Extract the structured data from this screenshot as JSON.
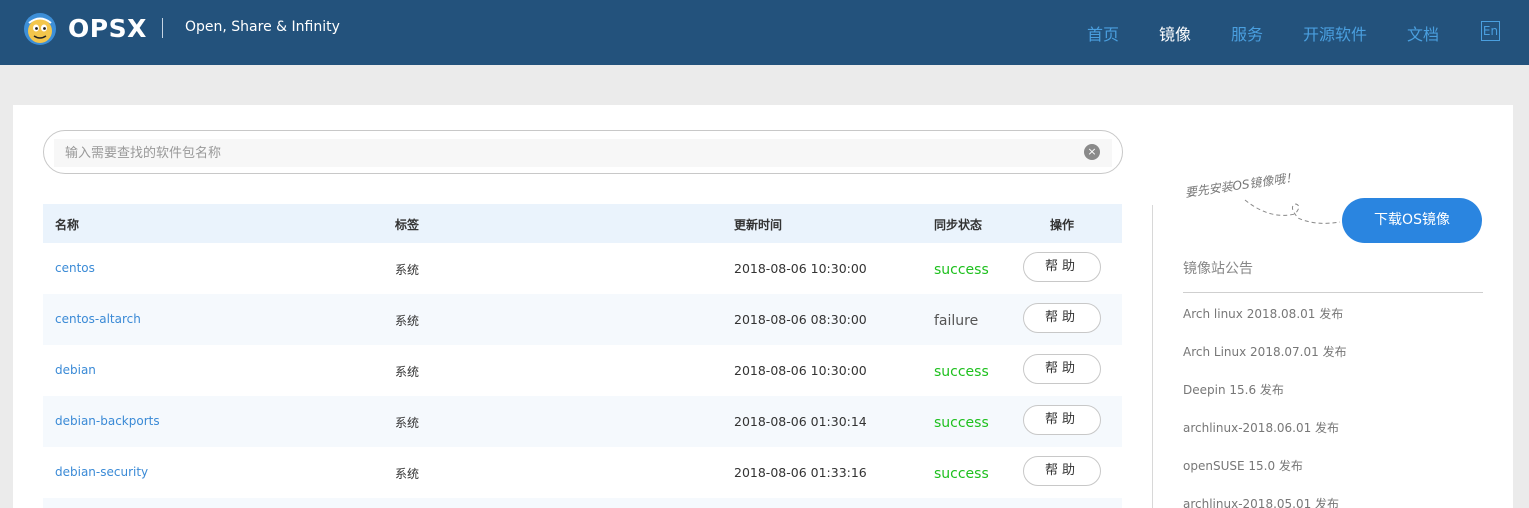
{
  "header": {
    "brand": "OPSX",
    "tagline": "Open, Share & Infinity",
    "nav": [
      {
        "label": "首页",
        "active": false
      },
      {
        "label": "镜像",
        "active": true
      },
      {
        "label": "服务",
        "active": false
      },
      {
        "label": "开源软件",
        "active": false
      },
      {
        "label": "文档",
        "active": false
      }
    ],
    "lang_label": "En"
  },
  "search": {
    "placeholder": "输入需要查找的软件包名称",
    "value": "",
    "clear_icon": "×"
  },
  "table": {
    "columns": [
      "名称",
      "标签",
      "更新时间",
      "同步状态",
      "操作"
    ],
    "rows": [
      {
        "name": "centos",
        "tag": "系统",
        "time": "2018-08-06 10:30:00",
        "status": "success",
        "action": "帮助"
      },
      {
        "name": "centos-altarch",
        "tag": "系统",
        "time": "2018-08-06 08:30:00",
        "status": "failure",
        "action": "帮助"
      },
      {
        "name": "debian",
        "tag": "系统",
        "time": "2018-08-06 10:30:00",
        "status": "success",
        "action": "帮助"
      },
      {
        "name": "debian-backports",
        "tag": "系统",
        "time": "2018-08-06 01:30:14",
        "status": "success",
        "action": "帮助"
      },
      {
        "name": "debian-security",
        "tag": "系统",
        "time": "2018-08-06 01:33:16",
        "status": "success",
        "action": "帮助"
      }
    ]
  },
  "sidebar": {
    "hint": "要先安装OS镜像哦！",
    "download_label": "下载OS镜像",
    "notice_title": "镜像站公告",
    "notices": [
      "Arch linux 2018.08.01 发布",
      "Arch Linux 2018.07.01 发布",
      "Deepin 15.6 发布",
      "archlinux-2018.06.01 发布",
      "openSUSE 15.0 发布",
      "archlinux-2018.05.01 发布"
    ]
  },
  "colors": {
    "header_bg": "#23527c",
    "link": "#3a8ad6",
    "success": "#1ec01e",
    "primary_button": "#2a85e0"
  }
}
